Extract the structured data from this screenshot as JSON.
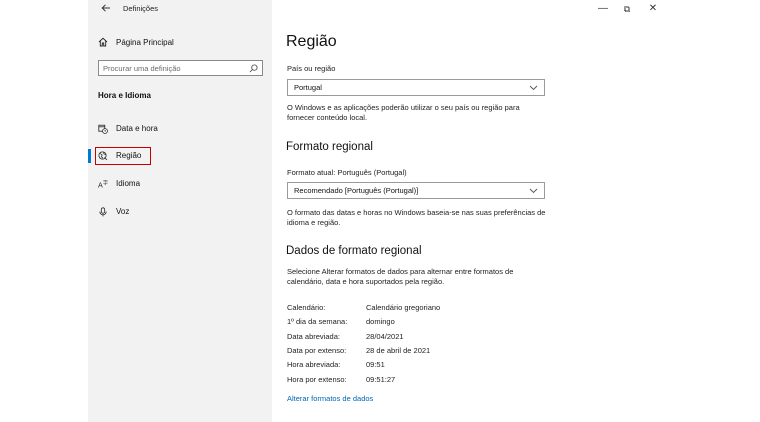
{
  "window": {
    "title": "Definições",
    "controls": {
      "minimize": "—",
      "maximize": "⧉",
      "close": "✕"
    }
  },
  "sidebar": {
    "home_label": "Página Principal",
    "search": {
      "placeholder": "Procurar uma definição",
      "value": ""
    },
    "section_title": "Hora e Idioma",
    "items": [
      {
        "label": "Data e hora",
        "icon": "clock-calendar-icon"
      },
      {
        "label": "Região",
        "icon": "globe-region-icon",
        "selected": true
      },
      {
        "label": "Idioma",
        "icon": "language-icon"
      },
      {
        "label": "Voz",
        "icon": "microphone-icon"
      }
    ]
  },
  "main": {
    "title": "Região",
    "country": {
      "label": "País ou região",
      "value": "Portugal",
      "description": "O Windows e as aplicações poderão utilizar o seu país ou região para fornecer conteúdo local."
    },
    "regional_format": {
      "heading": "Formato regional",
      "current_label": "Formato atual: Português (Portugal)",
      "value": "Recomendado [Português (Portugal)]",
      "description": "O formato das datas e horas no Windows baseia-se nas suas preferências de idioma e região."
    },
    "format_data": {
      "heading": "Dados de formato regional",
      "description": "Selecione Alterar formatos de dados para alternar entre formatos de calendário, data e hora suportados pela região.",
      "rows": [
        {
          "key": "Calendário:",
          "value": "Calendário gregoriano"
        },
        {
          "key": "1º dia da semana:",
          "value": "domingo"
        },
        {
          "key": "Data abreviada:",
          "value": "28/04/2021"
        },
        {
          "key": "Data por extenso:",
          "value": "28 de abril de 2021"
        },
        {
          "key": "Hora abreviada:",
          "value": "09:51"
        },
        {
          "key": "Hora por extenso:",
          "value": "09:51:27"
        }
      ],
      "link": "Alterar formatos de dados"
    }
  },
  "colors": {
    "accent": "#0078d7",
    "selection_box": "#c40000",
    "link": "#0066b4",
    "sidebar_bg": "#f2f2f2"
  }
}
